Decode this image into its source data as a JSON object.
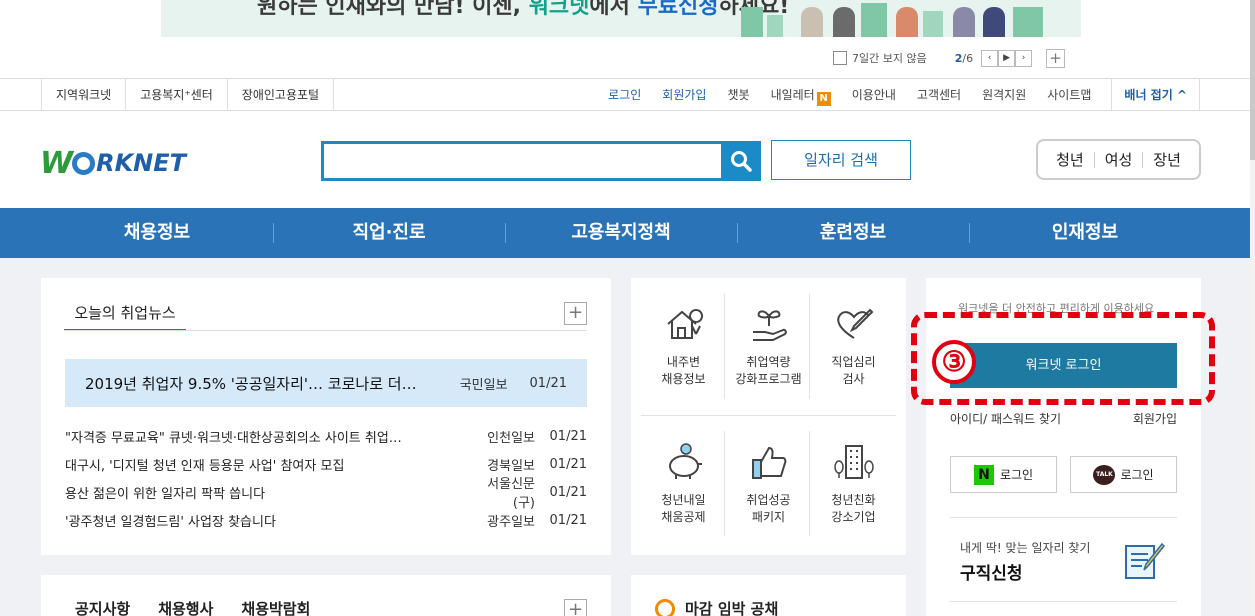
{
  "banner": {
    "headline_part1": "원하는 인재와의 만남! 이젠,",
    "headline_brand": "워크넷",
    "headline_part2": "에서",
    "headline_emph": "무료신청",
    "headline_part3": "하세요!",
    "hide_week_label": "7일간 보지 않음",
    "page_current": "2",
    "page_total": "/6",
    "prev_glyph": "‹",
    "play_glyph": "▶",
    "next_glyph": "›",
    "add_glyph": "+"
  },
  "util_left": [
    "지역워크넷",
    "고용복지⁺센터",
    "장애인고용포털"
  ],
  "util_right": {
    "login": "로그인",
    "signup": "회원가입",
    "chatbot": "챗봇",
    "letter": "내일레터",
    "letter_badge": "N",
    "guide": "이용안내",
    "customer": "고객센터",
    "remote": "원격지원",
    "sitemap": "사이트맵",
    "banner_fold": "배너 접기 ^"
  },
  "header": {
    "logo_w": "W",
    "logo_rest": "RKNET",
    "search_placeholder": "",
    "job_search_label": "일자리 검색",
    "targets": [
      "청년",
      "여성",
      "장년"
    ]
  },
  "gnb": [
    "채용정보",
    "직업·진로",
    "고용복지정책",
    "훈련정보",
    "인재정보"
  ],
  "news": {
    "tab_label": "오늘의 취업뉴스",
    "plus_glyph": "+",
    "headline": {
      "title": "2019년 취업자 9.5% '공공일자리'… 코로나로 더…",
      "source": "국민일보",
      "date": "01/21"
    },
    "items": [
      {
        "title": "\"자격증 무료교육\" 큐넷·워크넷·대한상공회의소 사이트 취업…",
        "source": "인천일보",
        "date": "01/21"
      },
      {
        "title": "대구시, '디지털 청년 인재 등용문 사업' 참여자 모집",
        "source": "경북일보",
        "date": "01/21"
      },
      {
        "title": "용산 젊은이 위한 일자리 팍팍 씁니다",
        "source": "서울신문(구)",
        "date": "01/21"
      },
      {
        "title": "'광주청년 일경험드림' 사업장 찾습니다",
        "source": "광주일보",
        "date": "01/21"
      }
    ]
  },
  "services": [
    {
      "label": "내주변\n채용정보",
      "icon": "house-location-icon"
    },
    {
      "label": "취업역량\n강화프로그램",
      "icon": "sprout-hand-icon"
    },
    {
      "label": "직업심리\n검사",
      "icon": "heart-pen-icon"
    },
    {
      "label": "청년내일\n채움공제",
      "icon": "piggy-bank-icon"
    },
    {
      "label": "취업성공\n패키지",
      "icon": "thumbs-up-icon"
    },
    {
      "label": "청년친화\n강소기업",
      "icon": "building-trees-icon"
    }
  ],
  "login": {
    "faded_text": "워크넷을 더 안전하고 편리하게 이용하세요",
    "step_number": "③",
    "worknet_login": "워크넷 로그인",
    "find_id_pw": "아이디/ 패스워드 찾기",
    "signup": "회원가입",
    "naver_n": "N",
    "naver_login": "로그인",
    "kakao_talk": "TALK",
    "kakao_login": "로그인",
    "jobreq_sub": "내게 딱! 맞는 일자리 찾기",
    "jobreq_title": "구직신청"
  },
  "notice": {
    "tabs": [
      "공지사항",
      "채용행사",
      "채용박람회"
    ],
    "plus_glyph": "+"
  },
  "deadline": {
    "title": "마감 임박 공채"
  },
  "colors": {
    "primary": "#2a73b6",
    "search": "#1b8bc7",
    "login_btn": "#1e7aa0",
    "highlight": "#e1000f",
    "headline_bg": "#d5e9f8"
  }
}
